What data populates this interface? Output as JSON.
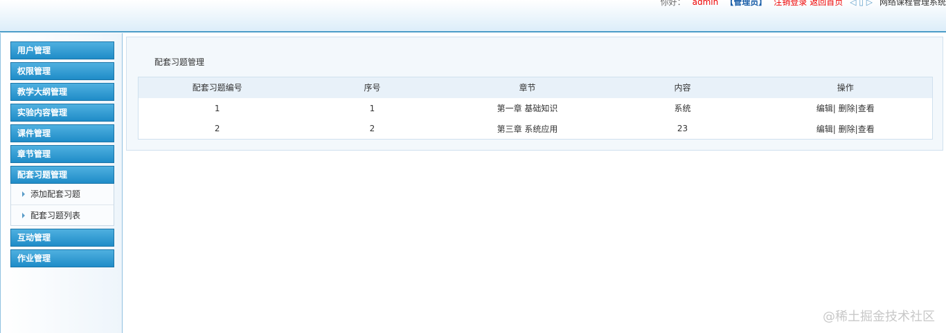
{
  "header": {
    "greeting": "你好：",
    "user": "admin",
    "role": "【管理员】",
    "logout": "注销登录",
    "home": "返回首页",
    "system_name": "网络课程管理系统"
  },
  "sidebar": {
    "groups": [
      {
        "label": "用户管理"
      },
      {
        "label": "权限管理"
      },
      {
        "label": "教学大纲管理"
      },
      {
        "label": "实验内容管理"
      },
      {
        "label": "课件管理"
      },
      {
        "label": "章节管理"
      },
      {
        "label": "配套习题管理",
        "items": [
          {
            "label": "添加配套习题"
          },
          {
            "label": "配套习题列表"
          }
        ]
      },
      {
        "label": "互动管理"
      },
      {
        "label": "作业管理"
      }
    ]
  },
  "main": {
    "title": "配套习题管理",
    "columns": [
      "配套习题编号",
      "序号",
      "章节",
      "内容",
      "操作"
    ],
    "rows": [
      {
        "id": "1",
        "seq": "1",
        "chapter": "第一章 基础知识",
        "content": "系统"
      },
      {
        "id": "2",
        "seq": "2",
        "chapter": "第三章 系统应用",
        "content": "23"
      }
    ],
    "actions": {
      "edit": "编辑",
      "delete": "删除",
      "view": "查看"
    }
  },
  "watermark": "@稀土掘金技术社区"
}
